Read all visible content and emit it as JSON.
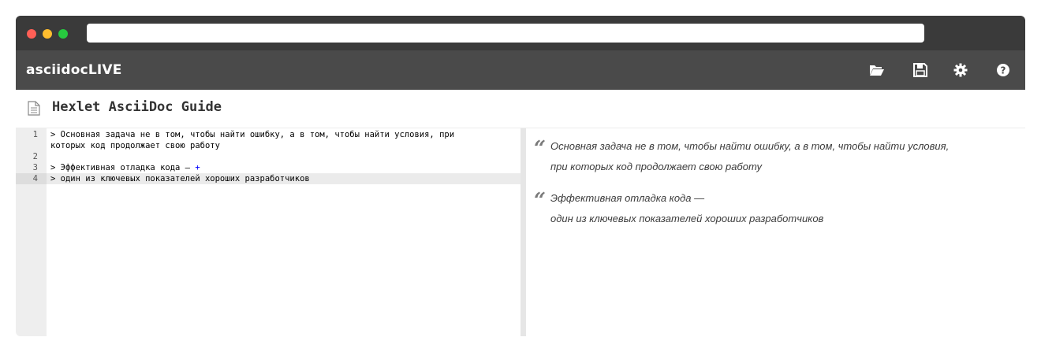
{
  "browser": {
    "url": ""
  },
  "app": {
    "brand": "asciidocLIVE",
    "toolbar_icons": [
      "folder-open-icon",
      "save-icon",
      "gear-icon",
      "help-icon"
    ],
    "colors": {
      "chrome": "#3a3a3a",
      "toolbar": "#4a4a4a",
      "close": "#ff5f56",
      "minimize": "#ffbd2e",
      "maximize": "#27c93f"
    }
  },
  "document": {
    "title": "Hexlet AsciiDoc Guide"
  },
  "editor": {
    "lines": [
      {
        "number": "1",
        "text": "> Основная задача не в том, чтобы найти ошибку, а в том, чтобы найти условия, при"
      },
      {
        "number": "",
        "text": "которых код продолжает свою работу"
      },
      {
        "number": "2",
        "text": ""
      },
      {
        "number": "3",
        "text": "> Эффективная отладка кода — ",
        "suffix": "+"
      },
      {
        "number": "4",
        "text": "> один из ключевых показателей хороших разработчиков"
      }
    ]
  },
  "preview": {
    "quotes": [
      {
        "mark": "“",
        "line1": "Основная задача не в том, чтобы найти ошибку, а в том, чтобы найти условия,",
        "line2": "при которых код продолжает свою работу"
      },
      {
        "mark": "“",
        "line1": "Эффективная отладка кода —",
        "line2": "один из ключевых показателей хороших разработчиков"
      }
    ]
  }
}
